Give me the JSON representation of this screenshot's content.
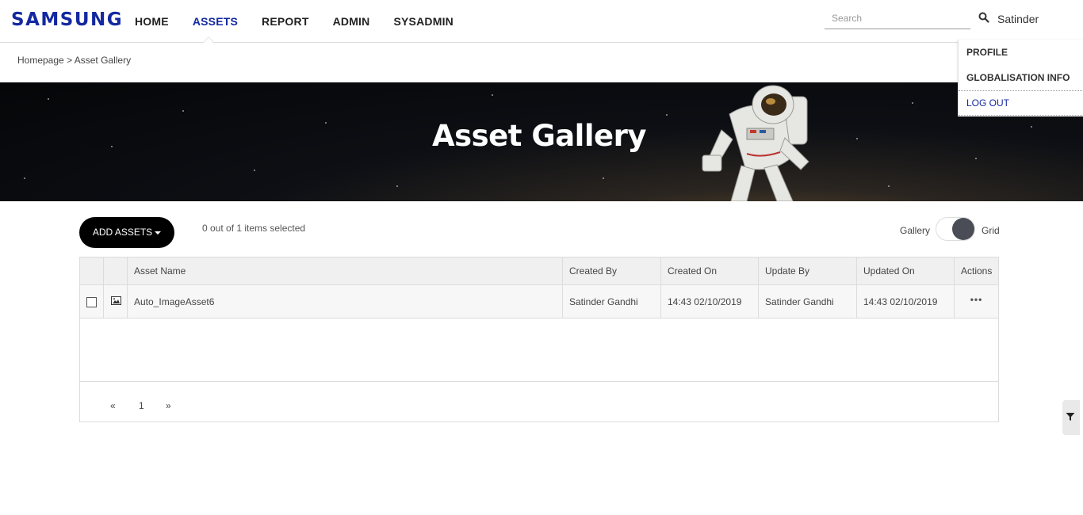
{
  "header": {
    "logo": "SAMSUNG",
    "nav": [
      "HOME",
      "ASSETS",
      "REPORT",
      "ADMIN",
      "SYSADMIN"
    ],
    "active_nav": "ASSETS",
    "search_placeholder": "Search",
    "user": "Satinder",
    "brand_color": "#1428a0"
  },
  "user_menu": {
    "items": [
      "PROFILE",
      "GLOBALISATION INFO",
      "LOG OUT"
    ]
  },
  "breadcrumb": {
    "home": "Homepage",
    "separator": ">",
    "current": "Asset Gallery"
  },
  "hero": {
    "title": "Asset Gallery"
  },
  "toolbar": {
    "add_label": "ADD ASSETS",
    "selection_text": "0 out of 1 items selected",
    "view_left": "Gallery",
    "view_right": "Grid"
  },
  "table": {
    "columns": [
      "Asset Name",
      "Created By",
      "Created On",
      "Update By",
      "Updated On",
      "Actions"
    ],
    "rows": [
      {
        "asset_name": "Auto_ImageAsset6",
        "created_by": "Satinder Gandhi",
        "created_on": "14:43 02/10/2019",
        "update_by": "Satinder Gandhi",
        "updated_on": "14:43 02/10/2019",
        "actions": "•••"
      }
    ]
  },
  "pagination": {
    "prev": "«",
    "page": "1",
    "next": "»"
  }
}
